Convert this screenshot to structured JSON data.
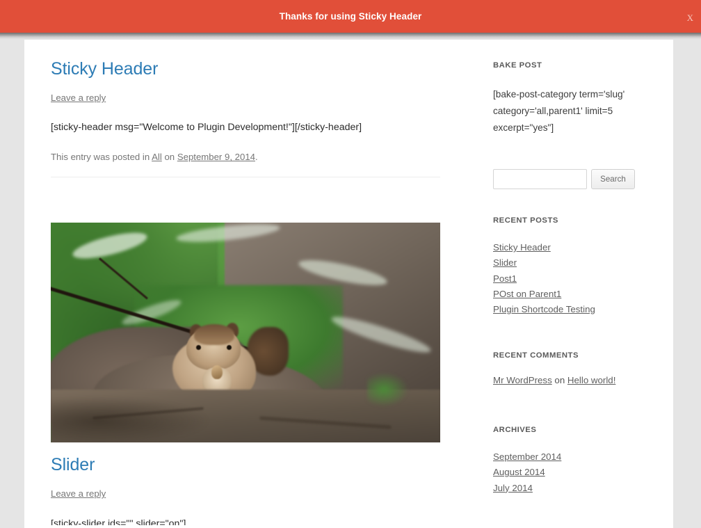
{
  "sticky_header": {
    "message": "Thanks for using Sticky Header",
    "close_label": "X",
    "bar_color": "#e14f39",
    "text_color": "#ffffff"
  },
  "theme": {
    "link_color": "#2d7cb5",
    "meta_color": "#767676",
    "page_bg": "#e5e5e5",
    "content_bg": "#ffffff"
  },
  "posts": [
    {
      "title": "Sticky Header",
      "comments_link": "Leave a reply",
      "content": "[sticky-header msg=\"Welcome to Plugin Development!\"][/sticky-header]",
      "meta_prefix": "This entry was posted in",
      "meta_category": "All",
      "meta_join": "on",
      "meta_date": "September 9, 2014",
      "meta_suffix": "."
    },
    {
      "title": "Slider",
      "comments_link": "Leave a reply",
      "content": "[sticky-slider ids=\"\" slider=\"on\"]"
    }
  ],
  "featured_image": {
    "alt": "Squirrel eating on a tree branch surrounded by green leaves"
  },
  "sidebar": {
    "bake_post": {
      "title": "BAKE POST",
      "text": "[bake-post-category term='slug' category='all,parent1' limit=5 excerpt=\"yes\"]"
    },
    "search": {
      "value": "",
      "placeholder": "",
      "button_label": "Search"
    },
    "recent_posts": {
      "title": "RECENT POSTS",
      "items": [
        "Sticky Header",
        "Slider",
        "Post1",
        "POst on Parent1",
        "Plugin Shortcode Testing"
      ]
    },
    "recent_comments": {
      "title": "RECENT COMMENTS",
      "author": "Mr WordPress",
      "join": "on",
      "post": "Hello world!"
    },
    "archives": {
      "title": "ARCHIVES",
      "items": [
        "September 2014",
        "August 2014",
        "July 2014"
      ]
    }
  }
}
